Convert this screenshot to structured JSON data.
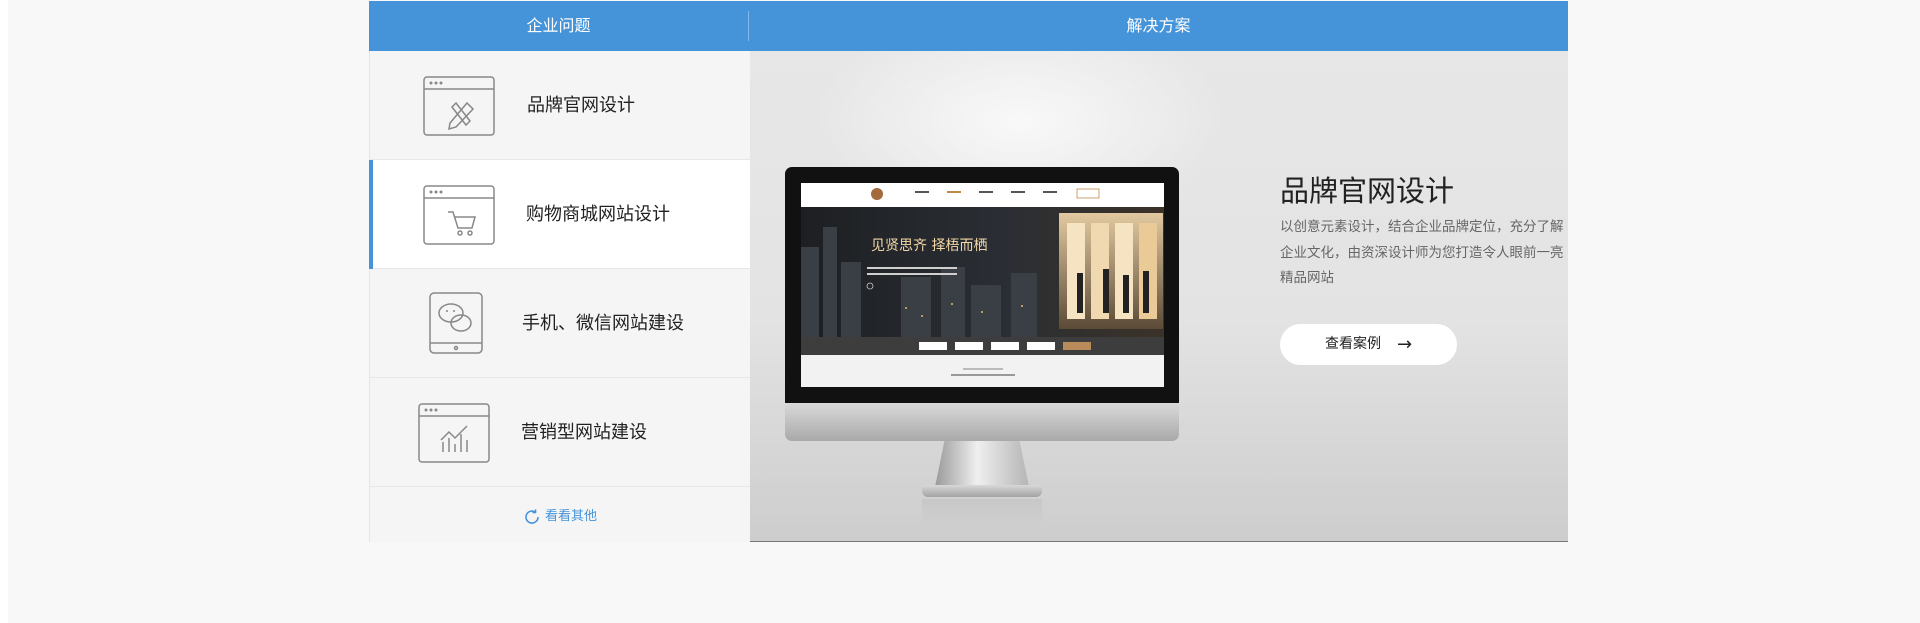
{
  "header": {
    "left_title": "企业问题",
    "right_title": "解决方案"
  },
  "problems": [
    {
      "label": "品牌官网设计",
      "icon": "pen-brush-browser-icon",
      "active": false
    },
    {
      "label": "购物商城网站设计",
      "icon": "shopping-cart-browser-icon",
      "active": true
    },
    {
      "label": "手机、微信网站建设",
      "icon": "wechat-phone-icon",
      "active": false
    },
    {
      "label": "营销型网站建设",
      "icon": "bar-chart-browser-icon",
      "active": false
    }
  ],
  "more": {
    "label": "看看其他",
    "icon": "refresh-icon"
  },
  "solution": {
    "title": "品牌官网设计",
    "description": "以创意元素设计，结合企业品牌定位，充分了解企业文化，由资深设计师为您打造令人眼前一亮精品网站",
    "button_label": "查看案例",
    "button_icon": "arrow-right-icon"
  },
  "preview": {
    "hero_text": "见贤思齐 择梧而栖"
  },
  "colors": {
    "accent": "#4594da",
    "background": "#f8f8f8"
  }
}
